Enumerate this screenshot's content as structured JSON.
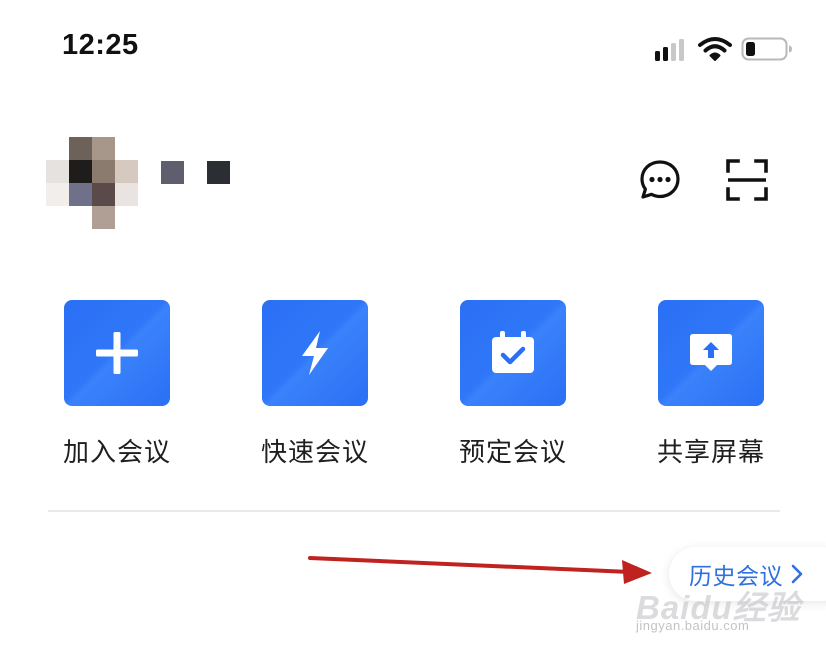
{
  "status_bar": {
    "time": "12:25",
    "signal_icon": "signal-icon",
    "wifi_icon": "wifi-icon",
    "battery_icon": "battery-icon",
    "battery_level": 0.25
  },
  "header": {
    "avatar": "pixelated-avatar",
    "chat_icon": "chat-bubble-icon",
    "scan_icon": "scan-icon"
  },
  "actions": [
    {
      "label": "加入会议",
      "icon": "plus-icon"
    },
    {
      "label": "快速会议",
      "icon": "lightning-icon"
    },
    {
      "label": "预定会议",
      "icon": "calendar-check-icon"
    },
    {
      "label": "共享屏幕",
      "icon": "screen-share-icon"
    }
  ],
  "history": {
    "label": "历史会议",
    "icon": "chevron-right-icon"
  },
  "colors": {
    "tile_blue": "#2a6ff5",
    "link_blue": "#2f6fe0",
    "arrow_red": "#c0221f"
  },
  "watermark": {
    "logo": "Baidu经验",
    "url": "jingyan.baidu.com"
  }
}
